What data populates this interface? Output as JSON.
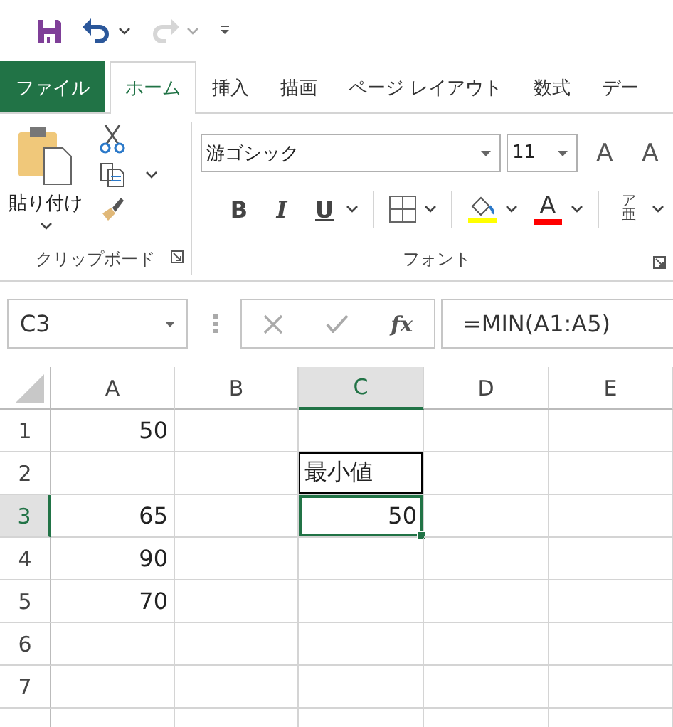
{
  "quick_access": [
    {
      "kind": "save",
      "disabled": false
    },
    {
      "kind": "undo",
      "disabled": false
    },
    {
      "kind": "redo",
      "disabled": true
    },
    {
      "kind": "customize",
      "disabled": false
    }
  ],
  "ribbon_tabs": [
    {
      "label": "ファイル",
      "kind": "file",
      "selected": false
    },
    {
      "label": "ホーム",
      "kind": "tab",
      "selected": true
    },
    {
      "label": "挿入",
      "kind": "tab",
      "selected": false
    },
    {
      "label": "描画",
      "kind": "tab",
      "selected": false
    },
    {
      "label": "ページ レイアウト",
      "kind": "tab",
      "selected": false
    },
    {
      "label": "数式",
      "kind": "tab",
      "selected": false
    },
    {
      "label": "デー",
      "kind": "tab",
      "selected": false
    }
  ],
  "clipboard_group": {
    "paste_label": "貼り付け",
    "label": "クリップボード"
  },
  "font_group": {
    "font_name": "游ゴシック",
    "font_size": "11",
    "size_buttons": [
      "A",
      "A"
    ],
    "style_buttons": [
      {
        "label": "B",
        "kind": "bold"
      },
      {
        "label": "I",
        "kind": "italic"
      },
      {
        "label": "U",
        "kind": "underline"
      }
    ],
    "font_color_glyph": "A",
    "phonetic": {
      "ruby": "ア",
      "base": "亜"
    },
    "label": "フォント"
  },
  "formula_bar": {
    "name_box": "C3",
    "function_button": "fx",
    "formula": "=MIN(A1:A5)"
  },
  "sheet": {
    "columns": [
      {
        "label": "A",
        "selected": false
      },
      {
        "label": "B",
        "selected": false
      },
      {
        "label": "C",
        "selected": true
      },
      {
        "label": "D",
        "selected": false
      },
      {
        "label": "E",
        "selected": false
      }
    ],
    "rows": [
      {
        "label": "1",
        "selected": false,
        "cells": [
          {
            "value": "50",
            "kind": "number",
            "selected": false,
            "bordered": false
          }
        ]
      },
      {
        "label": "2",
        "selected": false,
        "cells": [
          null,
          null,
          {
            "value": "最小値",
            "kind": "text",
            "selected": false,
            "bordered": true
          }
        ]
      },
      {
        "label": "3",
        "selected": true,
        "cells": [
          {
            "value": "65",
            "kind": "number",
            "selected": false,
            "bordered": false
          },
          null,
          {
            "value": "50",
            "kind": "number",
            "selected": true,
            "bordered": false
          }
        ]
      },
      {
        "label": "4",
        "selected": false,
        "cells": [
          {
            "value": "90",
            "kind": "number",
            "selected": false,
            "bordered": false
          }
        ]
      },
      {
        "label": "5",
        "selected": false,
        "cells": [
          {
            "value": "70",
            "kind": "number",
            "selected": false,
            "bordered": false
          }
        ]
      },
      {
        "label": "6",
        "selected": false,
        "cells": []
      },
      {
        "label": "7",
        "selected": false,
        "cells": []
      }
    ]
  }
}
